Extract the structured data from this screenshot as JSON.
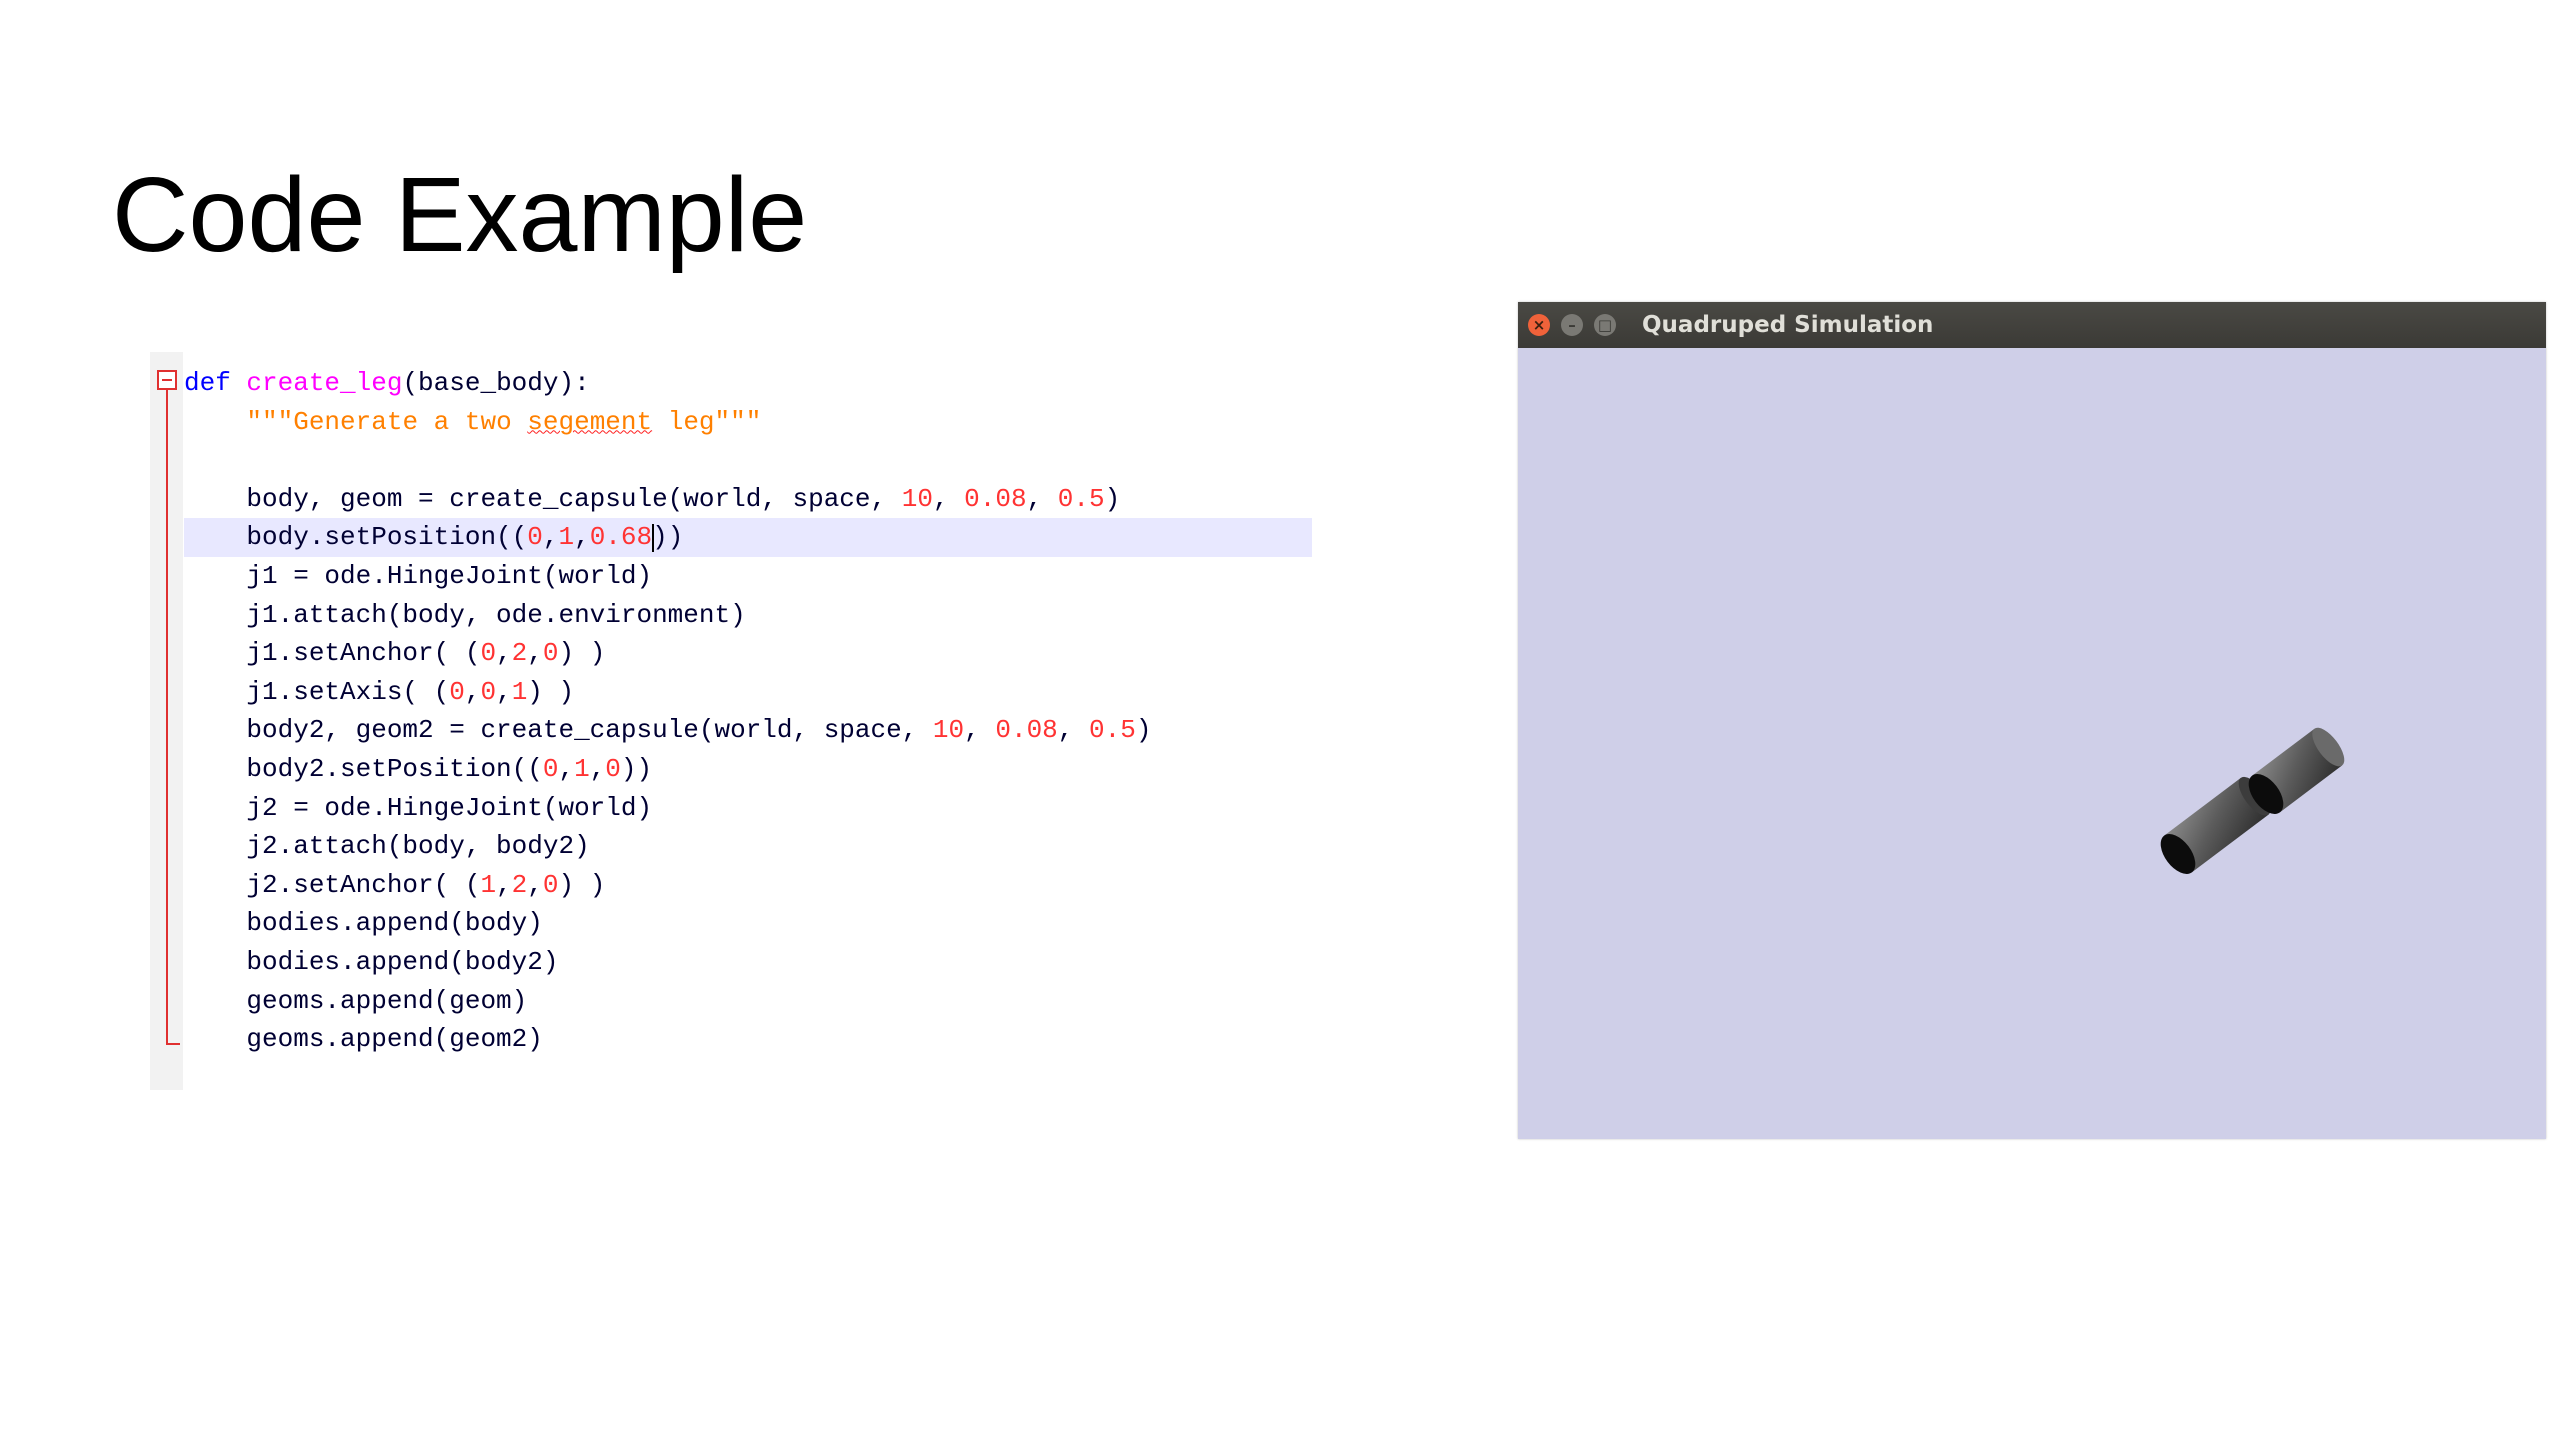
{
  "slide": {
    "title": "Code Example"
  },
  "code_editor": {
    "current_line_index": 4,
    "lines": [
      [
        {
          "t": "def",
          "c": "kw"
        },
        {
          "t": " "
        },
        {
          "t": "create_leg",
          "c": "fn"
        },
        {
          "t": "(base_body):"
        }
      ],
      [
        {
          "t": "    "
        },
        {
          "t": "\"\"\"Generate a two ",
          "c": "str"
        },
        {
          "t": "segement",
          "c": "str typo"
        },
        {
          "t": " leg\"\"\"",
          "c": "str"
        }
      ],
      [],
      [
        {
          "t": "    body, geom = create_capsule(world, space, "
        },
        {
          "t": "10",
          "c": "num"
        },
        {
          "t": ", "
        },
        {
          "t": "0.08",
          "c": "num"
        },
        {
          "t": ", "
        },
        {
          "t": "0.5",
          "c": "num"
        },
        {
          "t": ")"
        }
      ],
      [
        {
          "t": "    body.setPosition(("
        },
        {
          "t": "0",
          "c": "num"
        },
        {
          "t": ","
        },
        {
          "t": "1",
          "c": "num"
        },
        {
          "t": ","
        },
        {
          "t": "0.68",
          "c": "num"
        },
        {
          "t": "",
          "c": "caret"
        },
        {
          "t": "))"
        }
      ],
      [
        {
          "t": "    j1 = ode.HingeJoint(world)"
        }
      ],
      [
        {
          "t": "    j1.attach(body, ode.environment)"
        }
      ],
      [
        {
          "t": "    j1.setAnchor( ("
        },
        {
          "t": "0",
          "c": "num"
        },
        {
          "t": ","
        },
        {
          "t": "2",
          "c": "num"
        },
        {
          "t": ","
        },
        {
          "t": "0",
          "c": "num"
        },
        {
          "t": ") )"
        }
      ],
      [
        {
          "t": "    j1.setAxis( ("
        },
        {
          "t": "0",
          "c": "num"
        },
        {
          "t": ","
        },
        {
          "t": "0",
          "c": "num"
        },
        {
          "t": ","
        },
        {
          "t": "1",
          "c": "num"
        },
        {
          "t": ") )"
        }
      ],
      [
        {
          "t": "    body2, geom2 = create_capsule(world, space, "
        },
        {
          "t": "10",
          "c": "num"
        },
        {
          "t": ", "
        },
        {
          "t": "0.08",
          "c": "num"
        },
        {
          "t": ", "
        },
        {
          "t": "0.5",
          "c": "num"
        },
        {
          "t": ")"
        }
      ],
      [
        {
          "t": "    body2.setPosition(("
        },
        {
          "t": "0",
          "c": "num"
        },
        {
          "t": ","
        },
        {
          "t": "1",
          "c": "num"
        },
        {
          "t": ","
        },
        {
          "t": "0",
          "c": "num"
        },
        {
          "t": "))"
        }
      ],
      [
        {
          "t": "    j2 = ode.HingeJoint(world)"
        }
      ],
      [
        {
          "t": "    j2.attach(body, body2)"
        }
      ],
      [
        {
          "t": "    j2.setAnchor( ("
        },
        {
          "t": "1",
          "c": "num"
        },
        {
          "t": ","
        },
        {
          "t": "2",
          "c": "num"
        },
        {
          "t": ","
        },
        {
          "t": "0",
          "c": "num"
        },
        {
          "t": ") )"
        }
      ],
      [
        {
          "t": "    bodies.append(body)"
        }
      ],
      [
        {
          "t": "    bodies.append(body2)"
        }
      ],
      [
        {
          "t": "    geoms.append(geom)"
        }
      ],
      [
        {
          "t": "    geoms.append(geom2)"
        }
      ]
    ]
  },
  "sim_window": {
    "title": "Quadruped Simulation",
    "buttons": {
      "close": "×",
      "minimize": "–",
      "maximize": "□"
    },
    "colors": {
      "background": "#cfcfe8",
      "capsule": "#5a5a5a",
      "capsule_end": "#0c0c0c"
    }
  }
}
